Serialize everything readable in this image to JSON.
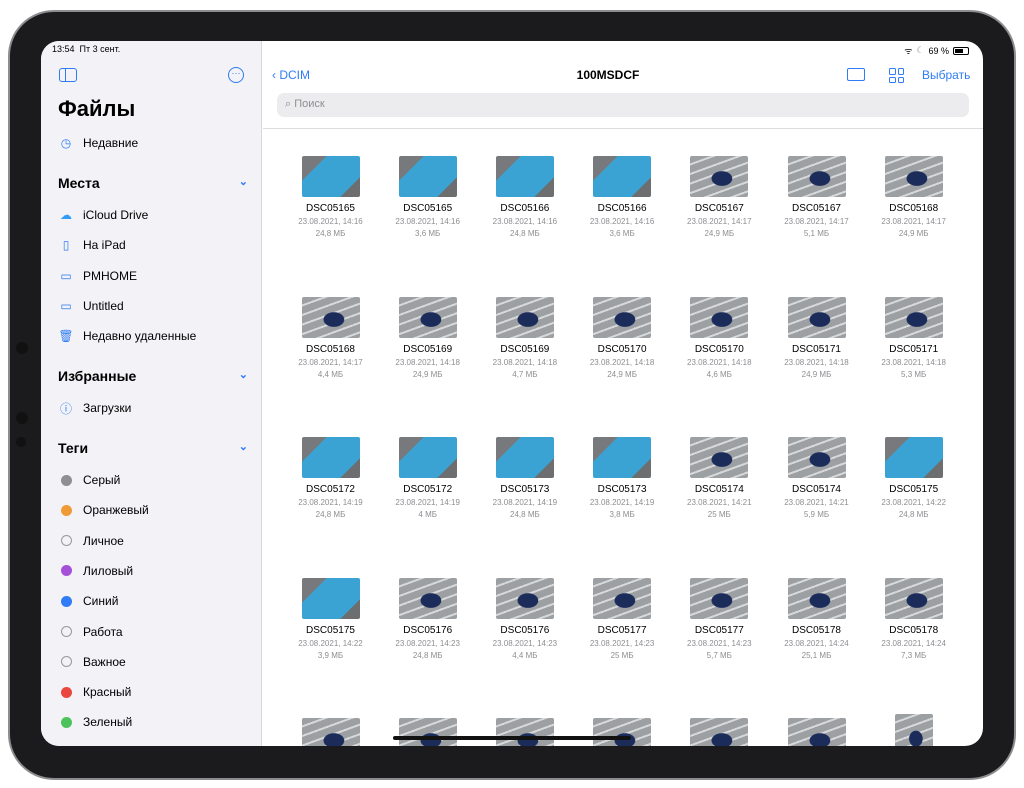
{
  "status": {
    "time": "13:54",
    "date": "Пт 3 сент.",
    "battery": "69 %"
  },
  "sidebar": {
    "title": "Файлы",
    "recent": "Недавние",
    "places": {
      "label": "Места",
      "items": [
        "iCloud Drive",
        "На iPad",
        "PMHOME",
        "Untitled",
        "Недавно удаленные"
      ]
    },
    "favorites": {
      "label": "Избранные",
      "items": [
        "Загрузки"
      ]
    },
    "tags": {
      "label": "Теги",
      "items": [
        {
          "label": "Серый",
          "color": "#8e8e93"
        },
        {
          "label": "Оранжевый",
          "color": "#f09a37"
        },
        {
          "label": "Личное",
          "color": ""
        },
        {
          "label": "Лиловый",
          "color": "#a550d8"
        },
        {
          "label": "Синий",
          "color": "#2f7cf6"
        },
        {
          "label": "Работа",
          "color": ""
        },
        {
          "label": "Важное",
          "color": ""
        },
        {
          "label": "Красный",
          "color": "#e9473d"
        },
        {
          "label": "Зеленый",
          "color": "#4cc35a"
        }
      ]
    }
  },
  "header": {
    "back": "DCIM",
    "title": "100MSDCF",
    "select": "Выбрать",
    "search_placeholder": "Поиск"
  },
  "files": [
    {
      "name": "DSC05165",
      "date": "23.08.2021, 14:16",
      "size": "24,8 МБ",
      "thumb": "box"
    },
    {
      "name": "DSC05165",
      "date": "23.08.2021, 14:16",
      "size": "3,6 МБ",
      "thumb": "box"
    },
    {
      "name": "DSC05166",
      "date": "23.08.2021, 14:16",
      "size": "24,8 МБ",
      "thumb": "box"
    },
    {
      "name": "DSC05166",
      "date": "23.08.2021, 14:16",
      "size": "3,6 МБ",
      "thumb": "box"
    },
    {
      "name": "DSC05167",
      "date": "23.08.2021, 14:17",
      "size": "24,9 МБ",
      "thumb": "phone"
    },
    {
      "name": "DSC05167",
      "date": "23.08.2021, 14:17",
      "size": "5,1 МБ",
      "thumb": "phone"
    },
    {
      "name": "DSC05168",
      "date": "23.08.2021, 14:17",
      "size": "24,9 МБ",
      "thumb": "phone"
    },
    {
      "name": "DSC05168",
      "date": "23.08.2021, 14:17",
      "size": "4,4 МБ",
      "thumb": "phone"
    },
    {
      "name": "DSC05169",
      "date": "23.08.2021, 14:18",
      "size": "24,9 МБ",
      "thumb": "phone"
    },
    {
      "name": "DSC05169",
      "date": "23.08.2021, 14:18",
      "size": "4,7 МБ",
      "thumb": "phone"
    },
    {
      "name": "DSC05170",
      "date": "23.08.2021, 14:18",
      "size": "24,9 МБ",
      "thumb": "phone"
    },
    {
      "name": "DSC05170",
      "date": "23.08.2021, 14:18",
      "size": "4,6 МБ",
      "thumb": "phone"
    },
    {
      "name": "DSC05171",
      "date": "23.08.2021, 14:18",
      "size": "24,9 МБ",
      "thumb": "phone"
    },
    {
      "name": "DSC05171",
      "date": "23.08.2021, 14:18",
      "size": "5,3 МБ",
      "thumb": "phone"
    },
    {
      "name": "DSC05172",
      "date": "23.08.2021, 14:19",
      "size": "24,8 МБ",
      "thumb": "box"
    },
    {
      "name": "DSC05172",
      "date": "23.08.2021, 14:19",
      "size": "4 МБ",
      "thumb": "box"
    },
    {
      "name": "DSC05173",
      "date": "23.08.2021, 14:19",
      "size": "24,8 МБ",
      "thumb": "box"
    },
    {
      "name": "DSC05173",
      "date": "23.08.2021, 14:19",
      "size": "3,8 МБ",
      "thumb": "box"
    },
    {
      "name": "DSC05174",
      "date": "23.08.2021, 14:21",
      "size": "25 МБ",
      "thumb": "phone"
    },
    {
      "name": "DSC05174",
      "date": "23.08.2021, 14:21",
      "size": "5,9 МБ",
      "thumb": "phone"
    },
    {
      "name": "DSC05175",
      "date": "23.08.2021, 14:22",
      "size": "24,8 МБ",
      "thumb": "box"
    },
    {
      "name": "DSC05175",
      "date": "23.08.2021, 14:22",
      "size": "3,9 МБ",
      "thumb": "box"
    },
    {
      "name": "DSC05176",
      "date": "23.08.2021, 14:23",
      "size": "24,8 МБ",
      "thumb": "phone"
    },
    {
      "name": "DSC05176",
      "date": "23.08.2021, 14:23",
      "size": "4,4 МБ",
      "thumb": "phone"
    },
    {
      "name": "DSC05177",
      "date": "23.08.2021, 14:23",
      "size": "25 МБ",
      "thumb": "phone"
    },
    {
      "name": "DSC05177",
      "date": "23.08.2021, 14:23",
      "size": "5,7 МБ",
      "thumb": "phone"
    },
    {
      "name": "DSC05178",
      "date": "23.08.2021, 14:24",
      "size": "25,1 МБ",
      "thumb": "phone"
    },
    {
      "name": "DSC05178",
      "date": "23.08.2021, 14:24",
      "size": "7,3 МБ",
      "thumb": "phone"
    },
    {
      "thumb": "phone"
    },
    {
      "thumb": "phone"
    },
    {
      "thumb": "phone"
    },
    {
      "thumb": "phone"
    },
    {
      "thumb": "phone"
    },
    {
      "thumb": "phone"
    },
    {
      "thumb": "tall"
    }
  ]
}
